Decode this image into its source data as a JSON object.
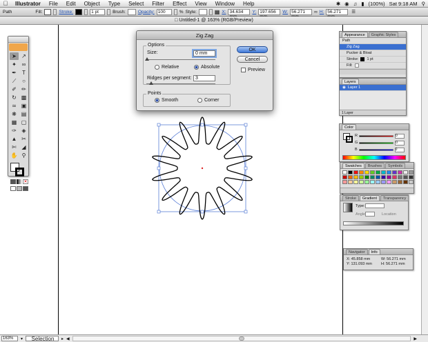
{
  "menubar": {
    "apple": "",
    "app_name": "Illustrator",
    "items": [
      "File",
      "Edit",
      "Object",
      "Type",
      "Select",
      "Filter",
      "Effect",
      "View",
      "Window",
      "Help"
    ],
    "battery": "(100%)",
    "clock": "Sat 9:18 AM"
  },
  "controlbar": {
    "object_type": "Path",
    "fill_label": "Fill:",
    "stroke_label": "Stroke:",
    "stroke_weight": "1 pt",
    "brush_label": "Brush:",
    "opacity_label": "Opacity:",
    "opacity_value": "100",
    "opacity_unit": "%",
    "style_label": "Style:",
    "x_label": "X:",
    "x_value": "34.634 mm",
    "y_label": "Y:",
    "y_value": "197.656 mm",
    "w_label": "W:",
    "w_value": "56.271 mm",
    "h_label": "H:",
    "h_value": "56.271 mm"
  },
  "document": {
    "title": "Untitled-1 @ 163% (RGB/Preview)",
    "zoom": "163%",
    "current_tool": "Selection"
  },
  "dialog": {
    "title": "Zig Zag",
    "options_label": "Options",
    "size_label": "Size:",
    "size_value": "0 mm",
    "relative_label": "Relative",
    "absolute_label": "Absolute",
    "ridges_label": "Ridges per segment:",
    "ridges_value": "3",
    "points_label": "Points",
    "smooth_label": "Smooth",
    "corner_label": "Corner",
    "ok_label": "OK",
    "cancel_label": "Cancel",
    "preview_label": "Preview",
    "absolute_selected": true,
    "smooth_selected": true,
    "preview_checked": false
  },
  "appearance_panel": {
    "tabs": [
      "Appearance",
      "Graphic Styles"
    ],
    "header": "Path",
    "rows": [
      "Zig Zag",
      "Pucker & Bloat",
      "Stroke:",
      "Fill:"
    ],
    "stroke_value": "1 pt"
  },
  "layers_panel": {
    "tab": "Layers",
    "layer_name": "Layer 1",
    "footer": "1 Layer"
  },
  "color_panel": {
    "tab": "Color",
    "channels": [
      {
        "name": "R",
        "value": "0"
      },
      {
        "name": "G",
        "value": "0"
      },
      {
        "name": "B",
        "value": "0"
      }
    ]
  },
  "swatches_panel": {
    "tabs": [
      "Swatches",
      "Brushes",
      "Symbols"
    ]
  },
  "gradient_panel": {
    "tabs": [
      "Stroke",
      "Gradient",
      "Transparency"
    ],
    "type_label": "Type:",
    "angle_label": "Angle",
    "location_label": "Location"
  },
  "info_panel": {
    "tabs": [
      "Navigator",
      "Info"
    ],
    "x_label": "X:",
    "x_value": "45.858 mm",
    "y_label": "Y:",
    "y_value": "131.093 mm",
    "w_label": "W:",
    "w_value": "56.271 mm",
    "h_label": "H:",
    "h_value": "56.271 mm"
  },
  "colors": {
    "selection_blue": "#3a6fd0",
    "bounding_box_blue": "#5b7fd6",
    "zigzag_stroke": "#000000"
  }
}
